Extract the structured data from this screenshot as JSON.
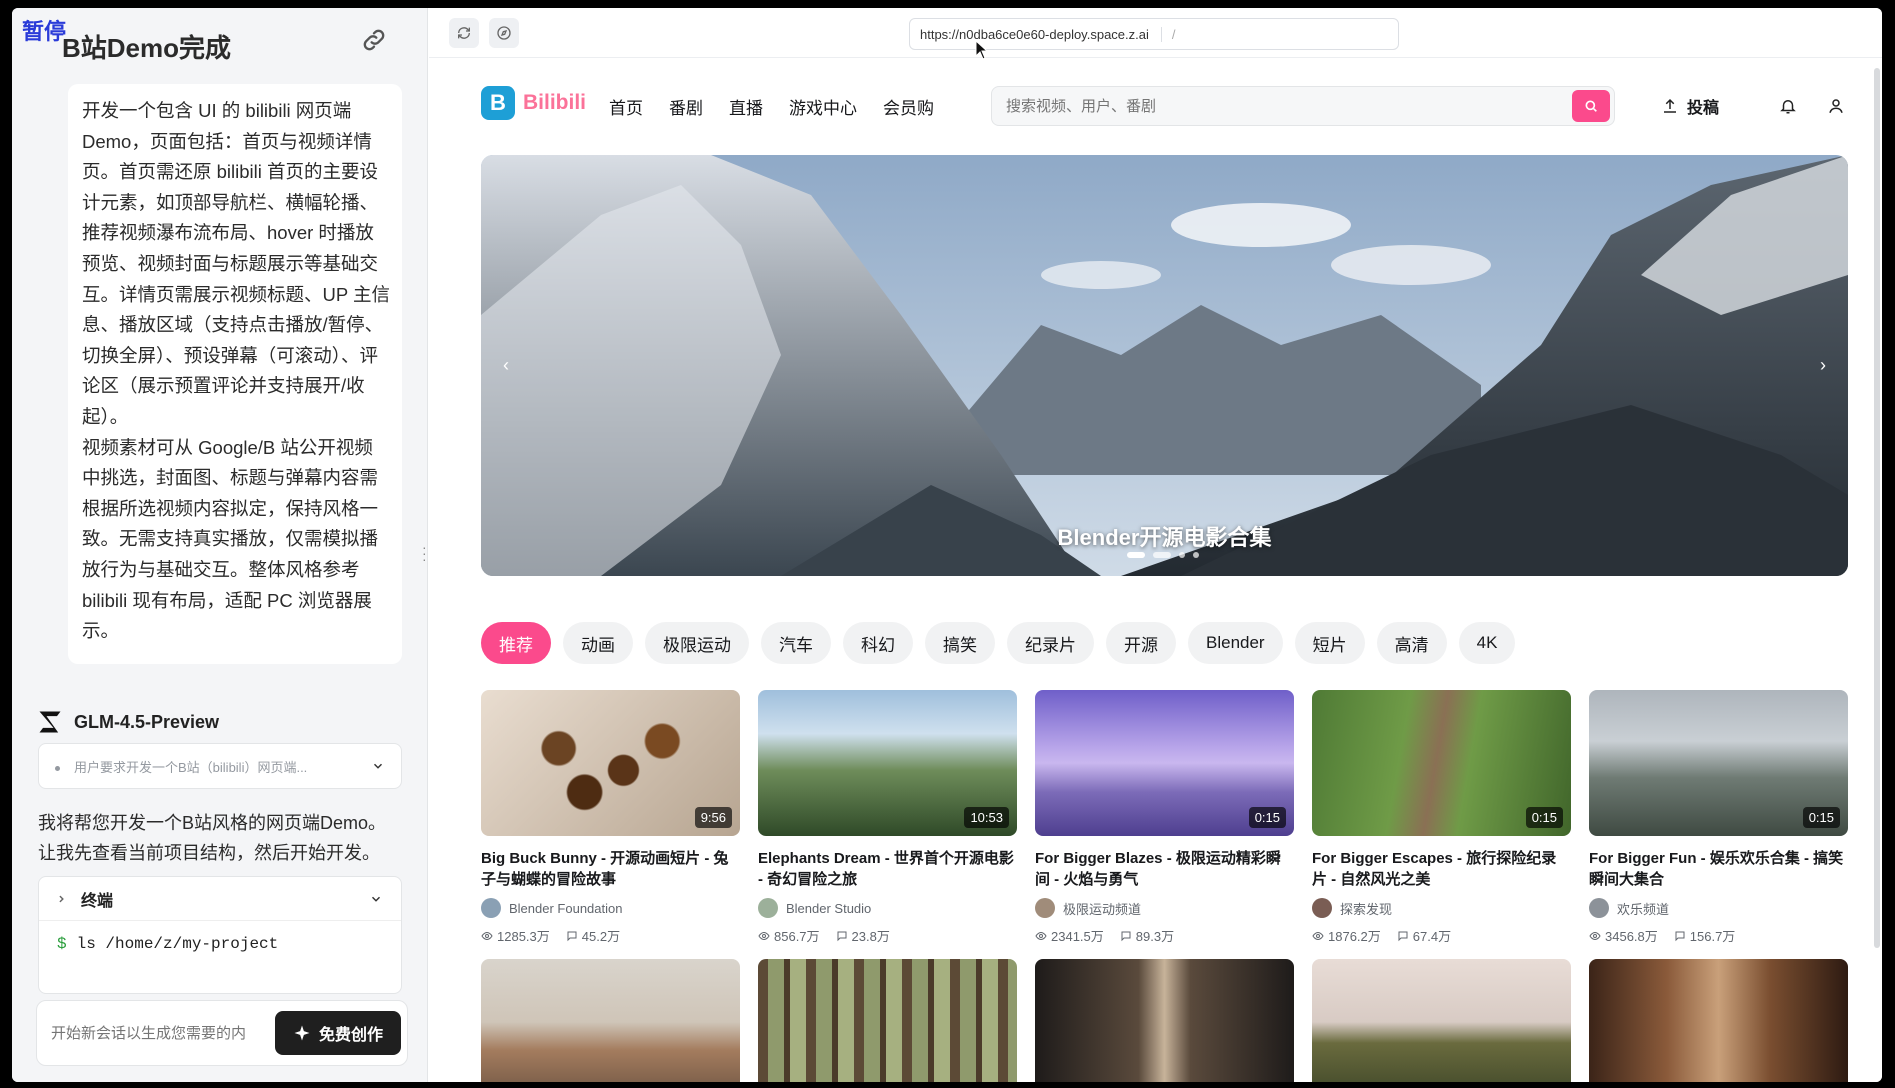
{
  "overlay": {
    "pause_label": "暂停"
  },
  "left_panel": {
    "title": "B站Demo完成",
    "prompt_paragraphs": [
      "开发一个包含 UI 的 bilibili 网页端 Demo，页面包括：首页与视频详情页。首页需还原 bilibili 首页的主要设计元素，如顶部导航栏、横幅轮播、推荐视频瀑布流布局、hover 时播放预览、视频封面与标题展示等基础交互。详情页需展示视频标题、UP 主信息、播放区域（支持点击播放/暂停、切换全屏）、预设弹幕（可滚动）、评论区（展示预置评论并支持展开/收起）。",
      "视频素材可从 Google/B 站公开视频中挑选，封面图、标题与弹幕内容需根据所选视频内容拟定，保持风格一致。无需支持真实播放，仅需模拟播放行为与基础交互。整体风格参考 bilibili 现有布局，适配 PC 浏览器展示。"
    ],
    "model_name": "GLM-4.5-Preview",
    "thinking_summary": "用户要求开发一个B站（bilibili）网页端...",
    "reply": "我将帮您开发一个B站风格的网页端Demo。让我先查看当前项目结构，然后开始开发。",
    "terminal": {
      "title": "终端",
      "command": "ls /home/z/my-project"
    },
    "new_chat_placeholder": "开始新会话以生成您需要的内",
    "create_button": "免费创作"
  },
  "browser": {
    "url": "https://n0dba6ce0e60-deploy.space.z.ai",
    "path": "/"
  },
  "site": {
    "logo_letter": "B",
    "logo_text": "Bilibili",
    "nav": [
      "首页",
      "番剧",
      "直播",
      "游戏中心",
      "会员购"
    ],
    "search_placeholder": "搜索视频、用户、番剧",
    "upload_label": "投稿",
    "banner_title": "Blender开源电影合集",
    "banner_prev": "‹",
    "banner_next": "›",
    "tabs": [
      "推荐",
      "动画",
      "极限运动",
      "汽车",
      "科幻",
      "搞笑",
      "纪录片",
      "开源",
      "Blender",
      "短片",
      "高清",
      "4K"
    ],
    "videos": [
      {
        "title": "Big Buck Bunny - 开源动画短片 - 兔子与蝴蝶的冒险故事",
        "up": "Blender Foundation",
        "duration": "9:56",
        "views": "1285.3万",
        "comments": "45.2万"
      },
      {
        "title": "Elephants Dream - 世界首个开源电影 - 奇幻冒险之旅",
        "up": "Blender Studio",
        "duration": "10:53",
        "views": "856.7万",
        "comments": "23.8万"
      },
      {
        "title": "For Bigger Blazes - 极限运动精彩瞬间 - 火焰与勇气",
        "up": "极限运动频道",
        "duration": "0:15",
        "views": "2341.5万",
        "comments": "89.3万"
      },
      {
        "title": "For Bigger Escapes - 旅行探险纪录片 - 自然风光之美",
        "up": "探索发现",
        "duration": "0:15",
        "views": "1876.2万",
        "comments": "67.4万"
      },
      {
        "title": "For Bigger Fun - 娱乐欢乐合集 - 搞笑瞬间大集合",
        "up": "欢乐频道",
        "duration": "0:15",
        "views": "3456.8万",
        "comments": "156.7万"
      }
    ]
  },
  "colors": {
    "brand_pink": "#fb7299",
    "accent": "#fb4a8c",
    "logo_blue": "#1e9fd6"
  }
}
